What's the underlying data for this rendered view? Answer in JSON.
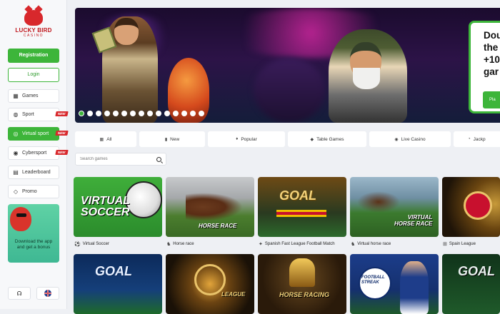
{
  "logo": {
    "name": "LUCKY BIRD",
    "sub": "CASINO"
  },
  "auth": {
    "registration": "Registration",
    "login": "Login"
  },
  "nav": [
    {
      "label": "Games",
      "icon": "cards-icon",
      "badge": ""
    },
    {
      "label": "Sport",
      "icon": "ball-icon",
      "badge": "NEW"
    },
    {
      "label": "Virtual sport",
      "icon": "globe-icon",
      "badge": "NEW"
    },
    {
      "label": "Cybersport",
      "icon": "gamepad-icon",
      "badge": "NEW"
    },
    {
      "label": "Leaderboard",
      "icon": "trophy-icon",
      "badge": ""
    },
    {
      "label": "Promo",
      "icon": "gift-icon",
      "badge": ""
    }
  ],
  "promo": {
    "text": "Download the app and get a bonus"
  },
  "footer": {
    "support_icon": "headphones-icon",
    "language_icon": "uk-flag-icon"
  },
  "banner": {
    "title": "Dou\nthe\n+10\ngar",
    "button": "Pla",
    "slides_total": 15,
    "active_slide": 1
  },
  "tabs": [
    {
      "label": "All",
      "icon": "grid-icon"
    },
    {
      "label": "New",
      "icon": "new-icon"
    },
    {
      "label": "Popular",
      "icon": "flame-icon"
    },
    {
      "label": "Table Games",
      "icon": "diamond-icon"
    },
    {
      "label": "Live Casino",
      "icon": "live-icon"
    },
    {
      "label": "Jackp",
      "icon": "jackpot-icon"
    }
  ],
  "search": {
    "placeholder": "Search games"
  },
  "games_row1": [
    {
      "name": "Virtual Soccer",
      "art": "VIRTUAL\nSOCCER"
    },
    {
      "name": "Horse race",
      "art": "HORSE RACE"
    },
    {
      "name": "Spanish Fast League Football Match",
      "art": "GOAL"
    },
    {
      "name": "Virtual horse race",
      "art": "VIRTUAL\nHORSE RACE"
    },
    {
      "name": "Spain League",
      "art": ""
    }
  ],
  "games_row2": [
    {
      "art": "GOAL"
    },
    {
      "art": "LEAGUE"
    },
    {
      "art": "HORSE RACING"
    },
    {
      "art": "FOOTBALL\nSTREAK"
    },
    {
      "art": "GOAL"
    }
  ],
  "colors": {
    "accent": "#3db53a",
    "brand_red": "#d8282c",
    "bg": "#eef0f4"
  }
}
